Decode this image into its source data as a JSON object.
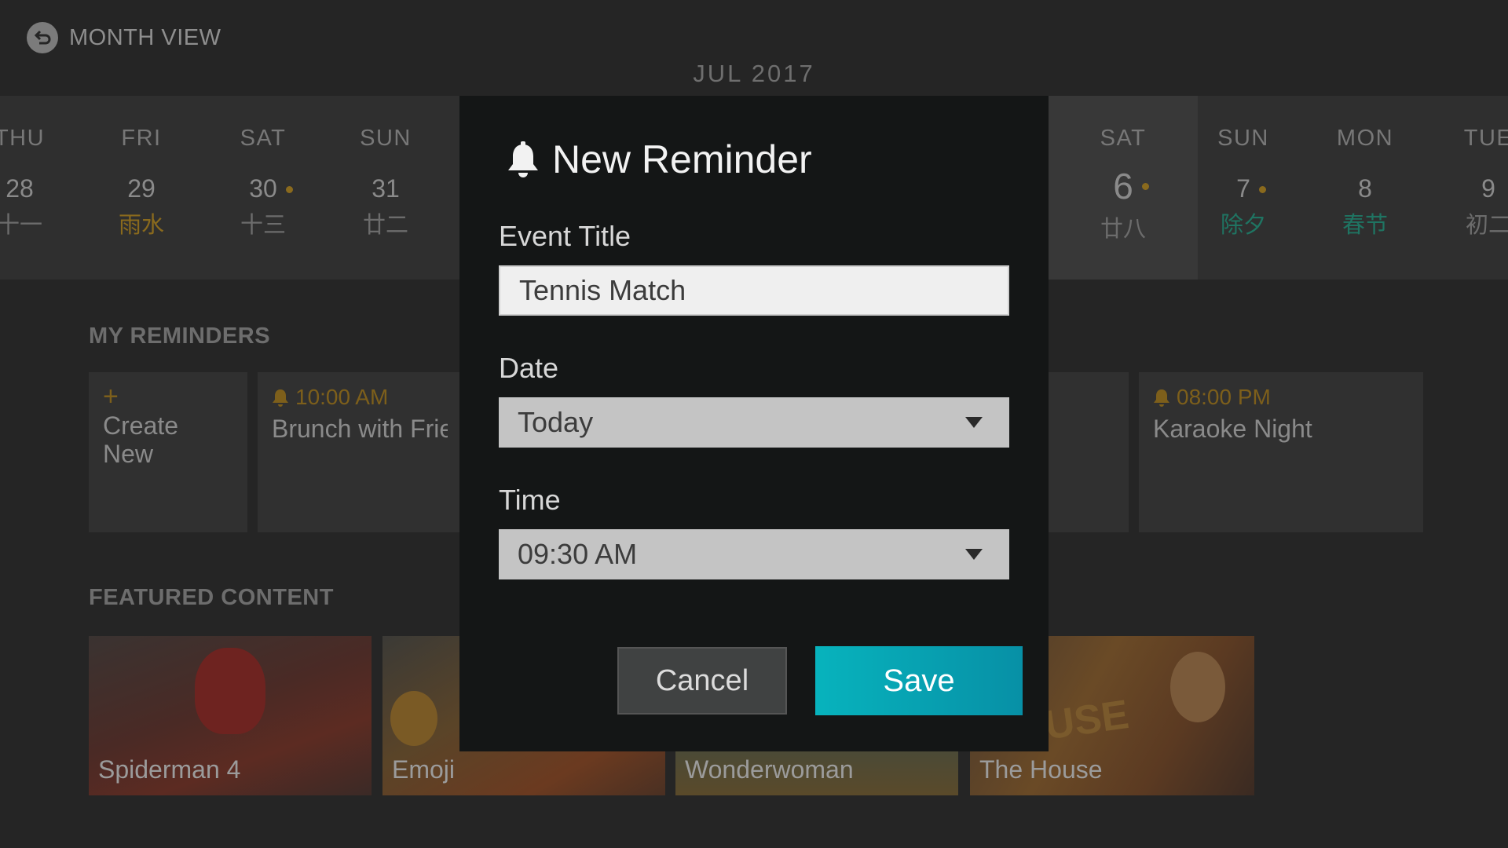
{
  "header": {
    "back_label": "MONTH VIEW",
    "month_title": "JUL 2017"
  },
  "calendar": {
    "days": [
      {
        "dow": "THU",
        "num": "28",
        "lunar": "十一",
        "dot": false,
        "lunar_style": "normal"
      },
      {
        "dow": "FRI",
        "num": "29",
        "lunar": "雨水",
        "dot": false,
        "lunar_style": "gold"
      },
      {
        "dow": "SAT",
        "num": "30",
        "lunar": "十三",
        "dot": true,
        "lunar_style": "normal"
      },
      {
        "dow": "SUN",
        "num": "31",
        "lunar": "廿二",
        "dot": false,
        "lunar_style": "normal"
      },
      {
        "dow": "SAT",
        "num": "6",
        "lunar": "廿八",
        "dot": true,
        "lunar_style": "normal",
        "selected": true
      },
      {
        "dow": "SUN",
        "num": "7",
        "lunar": "除夕",
        "dot": true,
        "lunar_style": "green"
      },
      {
        "dow": "MON",
        "num": "8",
        "lunar": "春节",
        "dot": false,
        "lunar_style": "green"
      },
      {
        "dow": "TUE",
        "num": "9",
        "lunar": "初二",
        "dot": false,
        "lunar_style": "normal"
      }
    ]
  },
  "reminders": {
    "section_title": "MY REMINDERS",
    "create": {
      "plus": "+",
      "label": "Create New"
    },
    "items": [
      {
        "time": "10:00 AM",
        "name": "Brunch with Frie"
      },
      {
        "time": "08:00 PM",
        "name": "Karaoke Night"
      }
    ]
  },
  "featured": {
    "section_title": "FEATURED CONTENT",
    "items": [
      {
        "title": "Spiderman 4"
      },
      {
        "title": "Emoji"
      },
      {
        "title": "Wonderwoman"
      },
      {
        "title": "The House"
      }
    ]
  },
  "dialog": {
    "title": "New Reminder",
    "icon": "bell-icon",
    "event_title_label": "Event Title",
    "event_title_value": "Tennis Match",
    "date_label": "Date",
    "date_value": "Today",
    "time_label": "Time",
    "time_value": "09:30 AM",
    "cancel_label": "Cancel",
    "save_label": "Save"
  },
  "colors": {
    "accent_gold": "#8a6a1d",
    "accent_green": "#1f7462",
    "save_button": "#07b3bd",
    "dialog_bg": "#141616"
  }
}
